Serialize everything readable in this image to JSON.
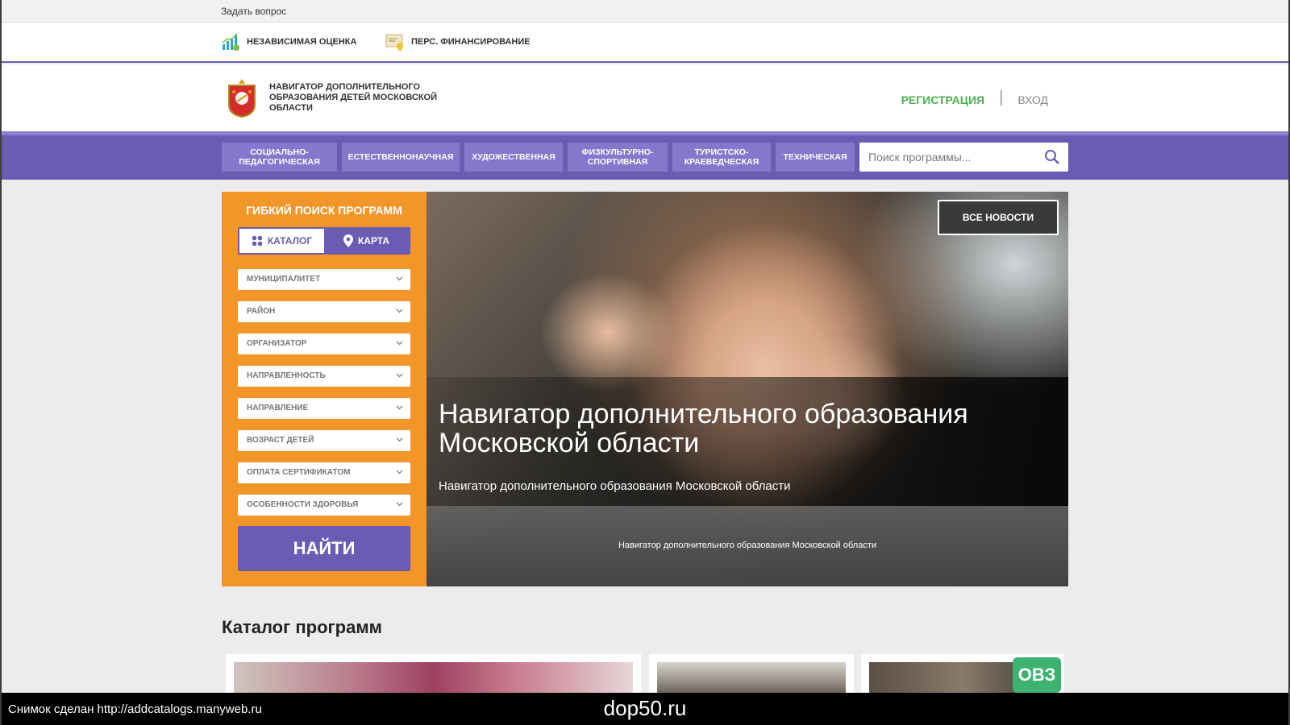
{
  "topline": {
    "ask_link": "Задать вопрос"
  },
  "services": [
    {
      "label": "НЕЗАВИСИМАЯ ОЦЕНКА",
      "icon": "chart-growth-icon"
    },
    {
      "label": "ПЕРС. ФИНАНСИРОВАНИЕ",
      "icon": "certificate-icon"
    }
  ],
  "header": {
    "brand": "НАВИГАТОР ДОПОЛНИТЕЛЬНОГО ОБРАЗОВАНИЯ ДЕТЕЙ МОСКОВСКОЙ ОБЛАСТИ",
    "register": "РЕГИСТРАЦИЯ",
    "separator": "|",
    "login": "ВХОД"
  },
  "nav": {
    "items": [
      "СОЦИАЛЬНО-ПЕДАГОГИЧЕСКАЯ",
      "ЕСТЕСТВЕННОНАУЧНАЯ",
      "ХУДОЖЕСТВЕННАЯ",
      "ФИЗКУЛЬТУРНО-СПОРТИВНАЯ",
      "ТУРИСТСКО-КРАЕВЕДЧЕСКАЯ",
      "ТЕХНИЧЕСКАЯ"
    ],
    "search_placeholder": "Поиск программы..."
  },
  "filters": {
    "title": "ГИБКИЙ ПОИСК ПРОГРАММ",
    "tab_catalog": "КАТАЛОГ",
    "tab_map": "КАРТА",
    "selects": [
      "МУНИЦИПАЛИТЕТ",
      "РАЙОН",
      "ОРГАНИЗАТОР",
      "НАПРАВЛЕННОСТЬ",
      "НАПРАВЛЕНИЕ",
      "ВОЗРАСТ ДЕТЕЙ",
      "ОПЛАТА СЕРТИФИКАТОМ",
      "ОСОБЕННОСТИ ЗДОРОВЬЯ"
    ],
    "find_button": "НАЙТИ"
  },
  "hero": {
    "all_news": "ВСЕ НОВОСТИ",
    "title": "Навигатор дополнительного образования Московской области",
    "subtitle": "Навигатор дополнительного образования Московской области",
    "footer_caption": "Навигатор дополнительного образования Московской области"
  },
  "catalog": {
    "title": "Каталог программ",
    "badge": "ОВЗ"
  },
  "caption_bar": {
    "left": "Снимок сделан http://addcatalogs.manyweb.ru",
    "center": "dop50.ru"
  },
  "colors": {
    "purple": "#6a5bb3",
    "orange": "#f2962a",
    "green": "#4caf50"
  }
}
